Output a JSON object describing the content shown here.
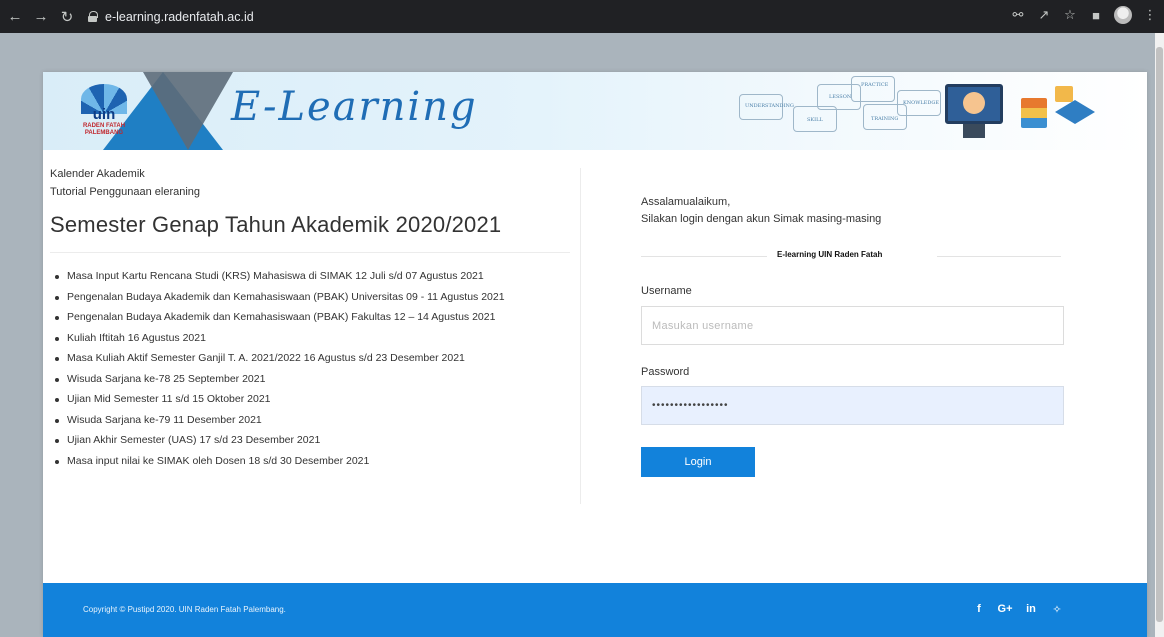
{
  "browser": {
    "url": "e-learning.radenfatah.ac.id",
    "icons": [
      "back-icon",
      "forward-icon",
      "reload-icon",
      "lock-icon",
      "key-icon",
      "share-icon",
      "star-icon",
      "window-icon",
      "profile-icon",
      "more-icon"
    ]
  },
  "banner": {
    "logo_text": "uin",
    "logo_subtext": "RADEN FATAH PALEMBANG",
    "title": "E-Learning",
    "diagram_words": [
      "Understanding",
      "Lesson",
      "Practice",
      "Knowledge",
      "Skill",
      "Training"
    ]
  },
  "left": {
    "links": [
      "Kalender Akademik",
      "Tutorial Penggunaan eleraning"
    ],
    "heading": "Semester Genap Tahun Akademik 2020/2021",
    "events": [
      "Masa Input Kartu Rencana Studi (KRS) Mahasiswa di SIMAK 12 Juli s/d 07 Agustus 2021",
      "Pengenalan Budaya Akademik dan Kemahasiswaan (PBAK) Universitas 09 - 11 Agustus 2021",
      "Pengenalan Budaya Akademik dan Kemahasiswaan (PBAK) Fakultas 12 – 14 Agustus 2021",
      "Kuliah Iftitah 16 Agustus 2021",
      "Masa Kuliah Aktif Semester Ganjil T. A. 2021/2022 16 Agustus s/d 23 Desember 2021",
      "Wisuda Sarjana ke-78 25 September 2021",
      "Ujian Mid Semester 11 s/d 15 Oktober 2021",
      "Wisuda Sarjana ke-79 11 Desember 2021",
      "Ujian Akhir Semester (UAS) 17 s/d 23 Desember 2021",
      "Masa input nilai ke SIMAK oleh Dosen 18 s/d 30 Desember 2021"
    ]
  },
  "login": {
    "greeting": "Assalamualaikum,",
    "instruction": "Silakan login dengan akun Simak masing-masing",
    "section_title": "E-learning UIN Raden Fatah",
    "username_label": "Username",
    "username_placeholder": "Masukan username",
    "username_value": "",
    "password_label": "Password",
    "password_value": "•••••••••••••••••",
    "button_label": "Login"
  },
  "footer": {
    "copyright": "Copyright © Pustipd 2020. UIN Raden Fatah Palembang.",
    "social": [
      {
        "name": "facebook-icon",
        "glyph": "f"
      },
      {
        "name": "google-plus-icon",
        "glyph": "G+"
      },
      {
        "name": "linkedin-icon",
        "glyph": "in"
      },
      {
        "name": "twitter-icon",
        "glyph": "✧"
      }
    ]
  },
  "colors": {
    "primary": "#1282db",
    "browser_bar": "#202124",
    "page_bg": "#aab4bc",
    "password_fill": "#e8f0fe"
  }
}
